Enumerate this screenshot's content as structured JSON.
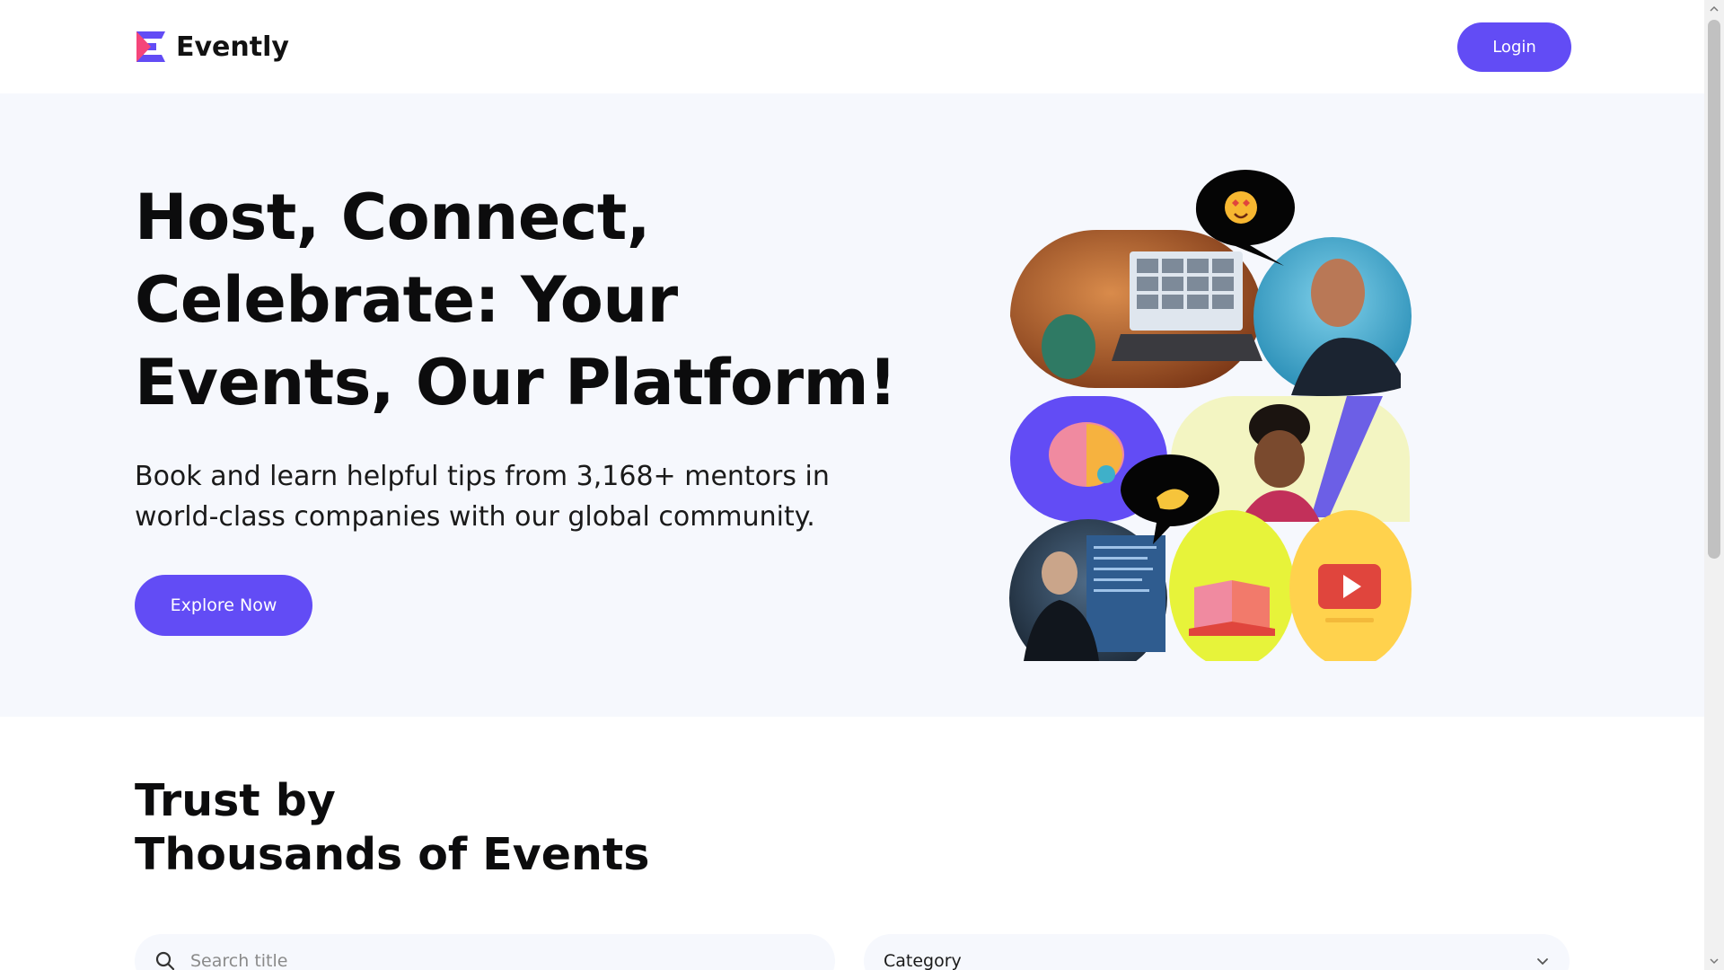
{
  "brand": {
    "name": "Evently",
    "logo_colors": [
      "#f5457a",
      "#624cf5"
    ]
  },
  "header": {
    "login_label": "Login"
  },
  "hero": {
    "title_lines": [
      "Host, Connect,",
      "Celebrate: Your",
      "Events, Our Platform!"
    ],
    "subtitle_lines": [
      "Book and learn helpful tips from 3,168+ mentors in",
      "world-class companies with our global community."
    ],
    "cta_label": "Explore Now"
  },
  "collage": {
    "tiles": [
      {
        "name": "laptop-video-call-photo",
        "color": "#b35a2a"
      },
      {
        "name": "smiling-man-photo",
        "color": "#2fa3c7"
      },
      {
        "name": "brain-idea-illustration",
        "color": "#624cf5"
      },
      {
        "name": "laughing-woman-photo",
        "color": "#f3f5c2"
      },
      {
        "name": "presenter-photo",
        "color": "#22303f"
      },
      {
        "name": "open-book-illustration",
        "color": "#e7f33a"
      },
      {
        "name": "video-play-illustration",
        "color": "#ffd24d"
      }
    ],
    "bubbles": [
      "heart-eyes-emoji",
      "waving-hand-emoji"
    ]
  },
  "trust": {
    "title_lines": [
      "Trust by",
      "Thousands of Events"
    ],
    "search_placeholder": "Search title",
    "category_label": "Category"
  },
  "colors": {
    "accent": "#624cf5",
    "hero_bg": "#f6f8fd",
    "text": "#0c0c0d"
  }
}
